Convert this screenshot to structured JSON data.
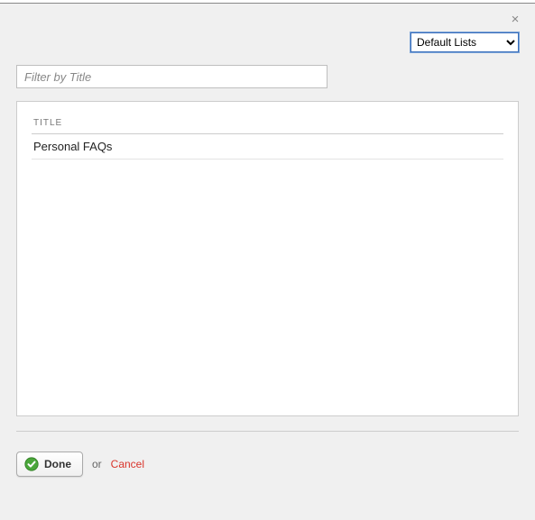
{
  "close_label": "×",
  "dropdown": {
    "selected": "Default Lists"
  },
  "filter": {
    "placeholder": "Filter by Title",
    "value": ""
  },
  "table": {
    "header": "TITLE",
    "rows": [
      "Personal FAQs"
    ]
  },
  "footer": {
    "done_label": "Done",
    "or_text": "or",
    "cancel_label": "Cancel"
  }
}
